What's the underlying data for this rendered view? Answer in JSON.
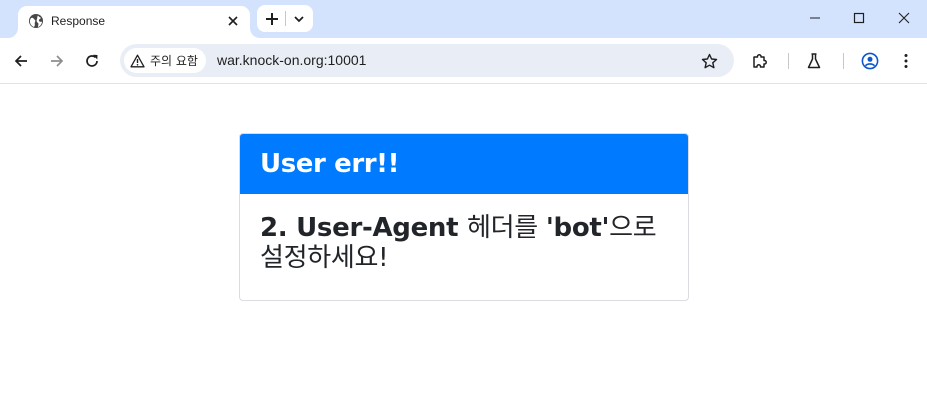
{
  "browser": {
    "tab": {
      "title": "Response",
      "favicon": "globe-icon"
    },
    "omnibox": {
      "security_label": "주의 요함",
      "url": "war.knock-on.org:10001"
    },
    "colors": {
      "tabstrip": "#d3e3fd",
      "omnibox": "#e9eef6",
      "profile": "#0b57d0"
    }
  },
  "page": {
    "card": {
      "header": "User err!!",
      "message_prefix": "2. User-Agent ",
      "message_middle": "헤더를 ",
      "message_bold": "'bot'",
      "message_suffix": "으로 설정하세요!"
    },
    "colors": {
      "header_bg": "#007bff",
      "text": "#212529"
    }
  }
}
